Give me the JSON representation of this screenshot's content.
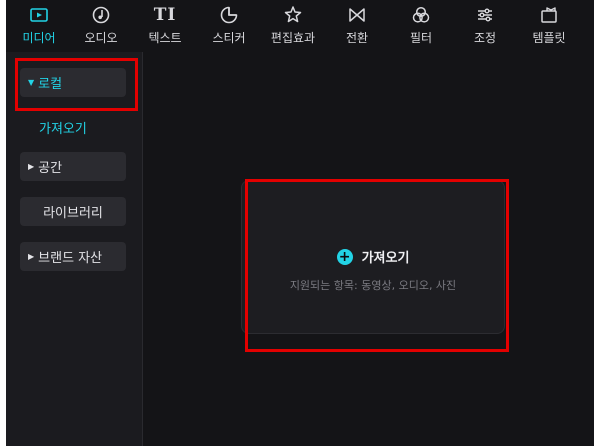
{
  "toolbar": {
    "items": [
      {
        "label": "미디어",
        "icon": "media-icon",
        "active": true
      },
      {
        "label": "오디오",
        "icon": "audio-icon"
      },
      {
        "label": "텍스트",
        "icon": "text-icon",
        "glyph": "TI"
      },
      {
        "label": "스티커",
        "icon": "sticker-icon"
      },
      {
        "label": "편집효과",
        "icon": "effects-icon"
      },
      {
        "label": "전환",
        "icon": "transition-icon"
      },
      {
        "label": "필터",
        "icon": "filter-icon"
      },
      {
        "label": "조정",
        "icon": "adjust-icon"
      },
      {
        "label": "템플릿",
        "icon": "template-icon"
      }
    ]
  },
  "sidebar": {
    "local": "로컬",
    "import": "가져오기",
    "space": "공간",
    "library": "라이브러리",
    "brand_assets": "브랜드 자산"
  },
  "main": {
    "import_label": "가져오기",
    "supported_text": "지원되는 항목: 동영상, 오디오, 사진"
  },
  "colors": {
    "accent": "#22d3e6",
    "highlight_box": "#e30000",
    "background": "#141417"
  }
}
